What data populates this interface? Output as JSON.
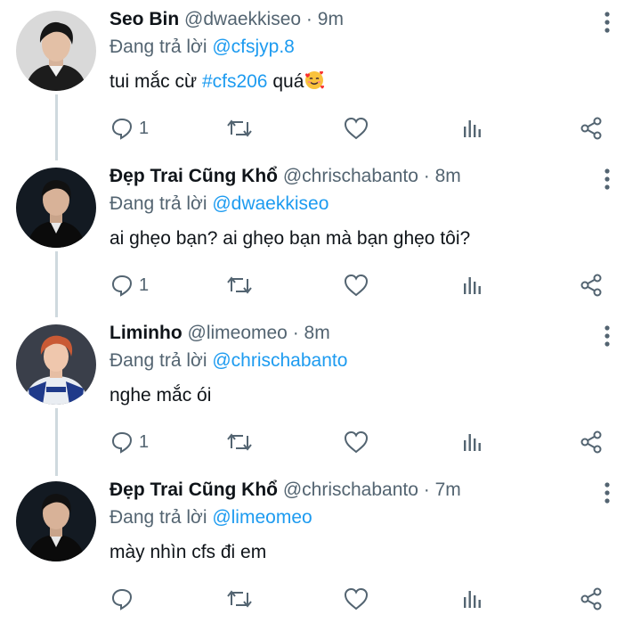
{
  "colors": {
    "link": "#1d9bf0",
    "secondary": "#536471",
    "text": "#0f1419"
  },
  "tweets": [
    {
      "name": "Seo Bin",
      "handle": "@dwaekkiseo",
      "separator": "·",
      "time": "9m",
      "reply_prefix": "Đang trả lời",
      "reply_to": "@cfsjyp.8",
      "text": "tui mắc cừ",
      "hashtag": "#cfs206",
      "text_after": "quá",
      "emoji": "smiling-face-with-hearts-emoji",
      "reply_count": "1"
    },
    {
      "name": "Đẹp Trai Cũng Khổ",
      "handle": "@chrischabanto",
      "separator": "·",
      "time": "8m",
      "reply_prefix": "Đang trả lời",
      "reply_to": "@dwaekkiseo",
      "text": "ai ghẹo bạn? ai ghẹo bạn mà bạn ghẹo tôi?",
      "reply_count": "1"
    },
    {
      "name": "Liminho",
      "handle": "@limeomeo",
      "separator": "·",
      "time": "8m",
      "reply_prefix": "Đang trả lời",
      "reply_to": "@chrischabanto",
      "text": "nghe mắc ói",
      "reply_count": "1"
    },
    {
      "name": "Đẹp Trai Cũng Khổ",
      "handle": "@chrischabanto",
      "separator": "·",
      "time": "7m",
      "reply_prefix": "Đang trả lời",
      "reply_to": "@limeomeo",
      "text": "mày nhìn cfs đi em",
      "reply_count": ""
    }
  ]
}
